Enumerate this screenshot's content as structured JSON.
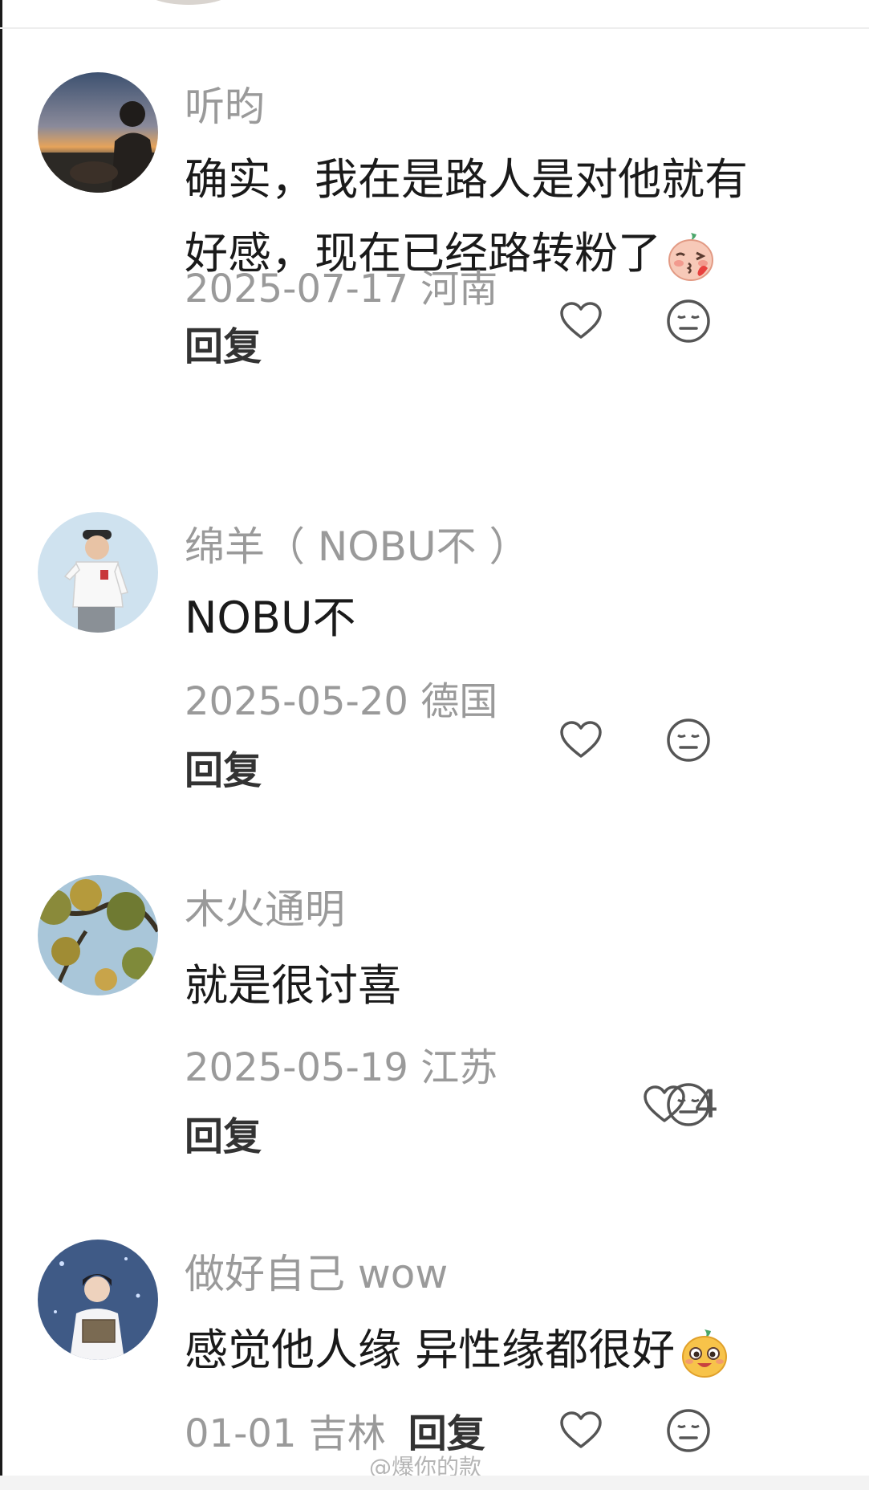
{
  "comments": [
    {
      "username": "听昀",
      "content_line1": "确实，我在是路人是对他就有",
      "content_line2": "好感，现在已经路转粉了",
      "emoji": "blush-kiss-emoji",
      "meta": "2025-07-17 河南",
      "reply_label": "回复",
      "like_count": "",
      "avatar": "sunset-silhouette-avatar"
    },
    {
      "username": "绵羊（ NOBU不 ）",
      "content_line1": "NOBU不",
      "meta": "2025-05-20 德国",
      "reply_label": "回复",
      "like_count": "",
      "avatar": "man-white-shirt-avatar"
    },
    {
      "username": "木火通明",
      "content_line1": "就是很讨喜",
      "meta": "2025-05-19 江苏",
      "reply_label": "回复",
      "like_count": "4",
      "avatar": "tree-branches-avatar"
    },
    {
      "username": "做好自己 wow",
      "content_line1": "感觉他人缘 异性缘都很好",
      "emoji": "happy-face-emoji",
      "meta": "01-01 吉林",
      "reply_label": "回复",
      "like_count": "",
      "avatar": "girl-reading-avatar"
    }
  ],
  "icons": {
    "like": "heart-outline-icon",
    "emote": "neutral-face-icon"
  },
  "colors": {
    "username": "#9a9a9a",
    "content": "#1a1a1a",
    "meta": "#9a9a9a",
    "icon": "#555555"
  },
  "watermark": "@爆你的款"
}
